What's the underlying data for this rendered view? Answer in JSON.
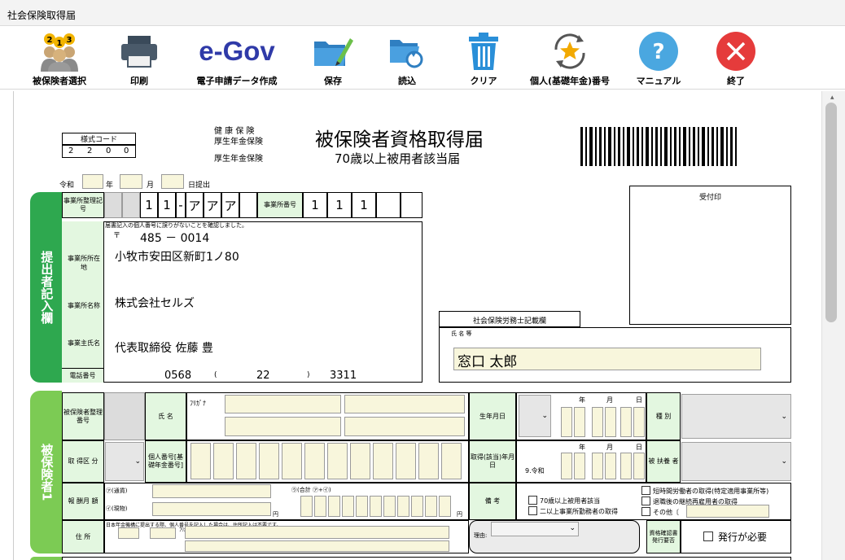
{
  "window": {
    "title": "社会保険取得届"
  },
  "toolbar": {
    "items": [
      {
        "label": "被保険者選択",
        "icon": "people-numbers-icon"
      },
      {
        "label": "印刷",
        "icon": "printer-icon"
      },
      {
        "label": "電子申請データ作成",
        "icon": "egov-logo"
      },
      {
        "label": "保存",
        "icon": "folder-pencil-icon"
      },
      {
        "label": "読込",
        "icon": "folder-load-icon"
      },
      {
        "label": "クリア",
        "icon": "trash-icon"
      },
      {
        "label": "個人(基礎年金)番号",
        "icon": "star-refresh-icon"
      },
      {
        "label": "マニュアル",
        "icon": "help-icon"
      },
      {
        "label": "終了",
        "icon": "close-icon"
      }
    ],
    "egov_text": "e-Gov"
  },
  "form": {
    "code_label": "様式コード",
    "code_digits": [
      "2",
      "2",
      "0",
      "0"
    ],
    "insurance_types": [
      "健 康 保 険",
      "厚生年金保険",
      "厚生年金保険"
    ],
    "title_main": "被保険者資格取得届",
    "title_sub": "70歳以上被用者該当届",
    "date_labels": {
      "era": "令和",
      "year": "年",
      "month": "月",
      "day": "日提出"
    },
    "submitter": {
      "section_label": "提出者記入欄",
      "office_code_label": "事業所整理記号",
      "office_code_cells": [
        "",
        "",
        "1",
        "1",
        "-",
        "ア",
        "ア",
        "ア"
      ],
      "office_no_label": "事業所番号",
      "office_no_cells": [
        "1",
        "1",
        "1",
        "",
        ""
      ],
      "note": "届書記入の個人番号に誤りがないことを確認しました。",
      "postal_mark": "〒",
      "postal_code": "485 － 0014",
      "address_label": "事業所所在地",
      "address": "小牧市安田区新町1ノ80",
      "name_label": "事業所名称",
      "name": "株式会社セルズ",
      "owner_label": "事業主氏名",
      "owner": "代表取締役 佐藤 豊",
      "phone_label": "電話番号",
      "phone": [
        "0568",
        "(",
        "22",
        ")",
        "3311"
      ]
    },
    "receipt_label": "受付印",
    "sharoshi_label": "社会保険労務士記載欄",
    "sharoshi_name_label": "氏 名 等",
    "sharoshi_name": "窓口 太郎",
    "insured": {
      "section_label": "被保険者1",
      "seiri_label": "被保険者整理番号",
      "name_label": "氏 名",
      "furigana_label": "ﾌﾘｶﾞﾅ",
      "birth_label": "生年月日",
      "ymd": [
        "年",
        "月",
        "日"
      ],
      "type_label": "種 別",
      "acq_kubun_label": "取 得区 分",
      "kojin_label": "個人番号[基礎年金番号]",
      "acq_date_label": "取得(該当)年月日",
      "era_reiwa": "9.令和",
      "dependents_label": "被 扶養 者",
      "pay_label": "報 酬月 額",
      "pay_currency": "㋐(通貨)",
      "pay_goods": "㋑(現物)",
      "pay_total": "㋒(合計 ㋐+㋑)",
      "yen": "円",
      "remarks_label": "備 考",
      "check_options": [
        "70歳以上被用者該当",
        "二以上事業所勤務者の取得",
        "短時間労働者の取得(特定適用事業所等)",
        "退職後の継続再雇用者の取得",
        "その他〔"
      ],
      "address_label": "住 所",
      "address_note": "日本年金機構に提出する際、個人番号を記入した場合は、住所記入は不要です。",
      "furigana2": "ﾌﾘｶﾞﾅ",
      "reason_label": "理由:",
      "certificate_label": "資格確認書発行要否",
      "certificate_check": "発行が必要"
    }
  }
}
